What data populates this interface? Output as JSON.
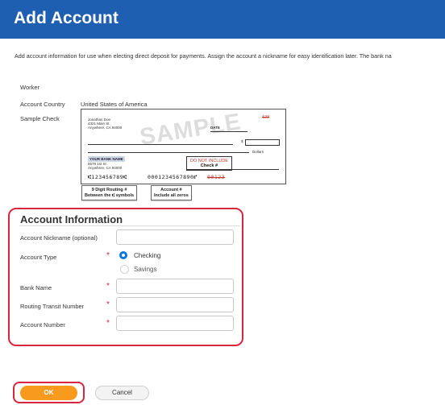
{
  "header": {
    "title": "Add Account"
  },
  "intro": "Add account information for use when electing direct deposit for payments. Assign the account a nickname for easy identification later. The bank na",
  "info": {
    "worker_label": "Worker",
    "country_label": "Account Country",
    "country_value": "United States of America",
    "sample_check_label": "Sample Check"
  },
  "check": {
    "name": "Jonathan Doe",
    "address1": "4321 Main St",
    "address2": "Anywhere, CA 94000",
    "number": "123",
    "date_label": "DATE",
    "dollar_sign": "$",
    "dollars_label": "Dollars",
    "watermark": "SAMPLE",
    "bank_name": "YOUR BANK NAME",
    "bank_addr1": "5678 1st St",
    "bank_addr2": "Anywhere, CA 94000",
    "dni_line1": "DO NOT INCLUDE",
    "dni_line2": "Check #",
    "micr_routing": "⑆123456789⑆",
    "micr_account": "0001234567890⑈",
    "micr_check": "00123",
    "callout_routing_1": "9 Digit Routing #",
    "callout_routing_2": "Between the ⑆ symbols",
    "callout_account_1": "Account #",
    "callout_account_2": "Include all zeros"
  },
  "account_info": {
    "title": "Account Information",
    "nickname_label": "Account Nickname (optional)",
    "nickname_value": "",
    "type_label": "Account Type",
    "type_options": [
      "Checking",
      "Savings"
    ],
    "type_selected": "Checking",
    "bank_name_label": "Bank Name",
    "bank_name_value": "",
    "routing_label": "Routing Transit Number",
    "routing_value": "",
    "account_number_label": "Account Number",
    "account_number_value": "",
    "required_mark": "*"
  },
  "buttons": {
    "ok": "OK",
    "cancel": "Cancel"
  },
  "colors": {
    "header": "#1f5fb1",
    "ok": "#f79a1e",
    "highlight": "#d7263d",
    "radio": "#0875e1"
  }
}
